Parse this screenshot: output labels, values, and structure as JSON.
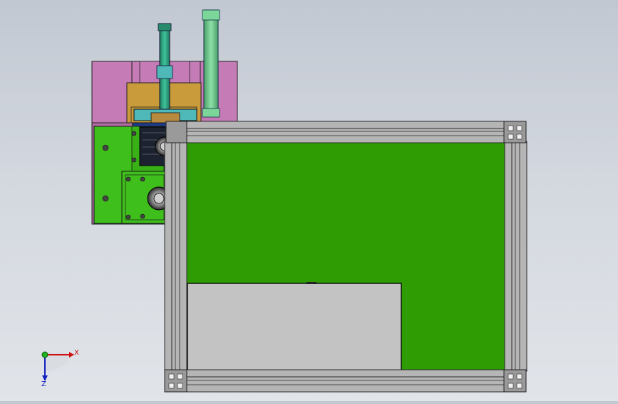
{
  "view": {
    "background_top": "#c2c8d2",
    "background_bottom": "#e1e4e9"
  },
  "colors": {
    "green_plate": "#2e9c02",
    "bright_green": "#3fbf1c",
    "pink_plate": "#c77ab6",
    "orange_plate": "#c89a3a",
    "navy_block": "#1e3c8c",
    "teal_rod": "#2aa07c",
    "light_green_rod": "#6ccc8c",
    "frame_gray": "#b4b4b4",
    "panel_gray": "#c2c2c2"
  },
  "triad": {
    "x_label": "X",
    "z_label": "Z",
    "icons": [
      "axis-x-icon",
      "axis-y-icon",
      "axis-z-icon"
    ]
  }
}
